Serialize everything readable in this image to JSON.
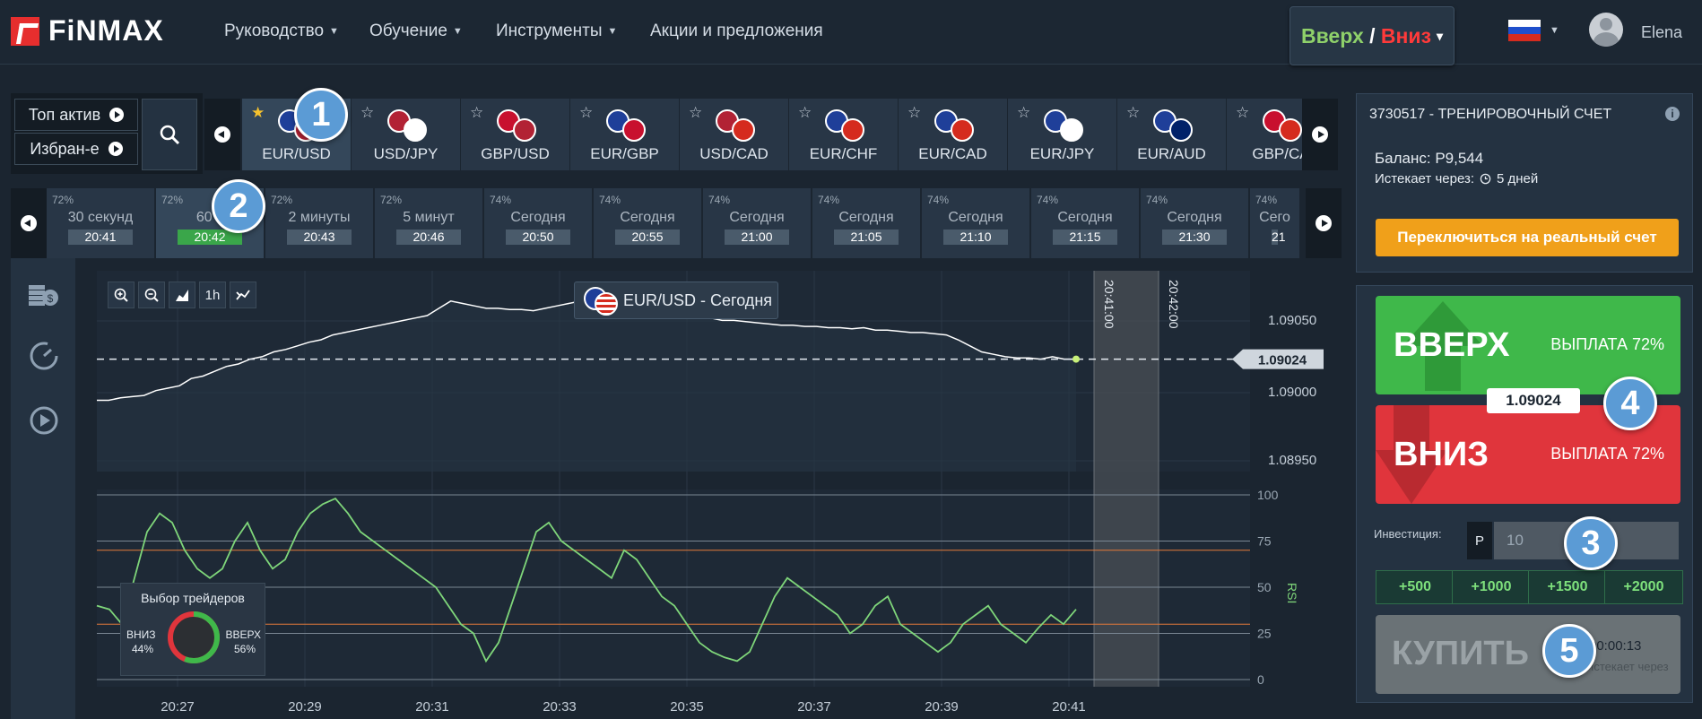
{
  "header": {
    "logo": "FiNMAX",
    "nav": [
      {
        "label": "Руководство",
        "dropdown": true
      },
      {
        "label": "Обучение",
        "dropdown": true
      },
      {
        "label": "Инструменты",
        "dropdown": true
      },
      {
        "label": "Акции и предложения",
        "dropdown": false
      }
    ],
    "mode_up": "Вверх",
    "mode_sep": " / ",
    "mode_down": "Вниз",
    "mode_caret": "▾",
    "language": "ru",
    "user_name": "Elena"
  },
  "asset_selector": {
    "top_assets": "Топ актив",
    "favorites": "Избран-е",
    "assets": [
      {
        "label": "EUR/USD",
        "favorite": true,
        "active": true
      },
      {
        "label": "USD/JPY",
        "favorite": false
      },
      {
        "label": "GBP/USD",
        "favorite": false
      },
      {
        "label": "EUR/GBP",
        "favorite": false
      },
      {
        "label": "USD/CAD",
        "favorite": false
      },
      {
        "label": "EUR/CHF",
        "favorite": false
      },
      {
        "label": "EUR/CAD",
        "favorite": false
      },
      {
        "label": "EUR/JPY",
        "favorite": false
      },
      {
        "label": "EUR/AUD",
        "favorite": false
      },
      {
        "label": "GBP/CA",
        "favorite": false
      }
    ]
  },
  "expiry_selector": {
    "options": [
      {
        "payout": "72%",
        "name": "30 секунд",
        "time": "20:41"
      },
      {
        "payout": "72%",
        "name": "60 с",
        "time": "20:42",
        "active": true
      },
      {
        "payout": "72%",
        "name": "2 минуты",
        "time": "20:43"
      },
      {
        "payout": "72%",
        "name": "5 минут",
        "time": "20:46"
      },
      {
        "payout": "74%",
        "name": "Сегодня",
        "time": "20:50"
      },
      {
        "payout": "74%",
        "name": "Сегодня",
        "time": "20:55"
      },
      {
        "payout": "74%",
        "name": "Сегодня",
        "time": "21:00"
      },
      {
        "payout": "74%",
        "name": "Сегодня",
        "time": "21:05"
      },
      {
        "payout": "74%",
        "name": "Сегодня",
        "time": "21:10"
      },
      {
        "payout": "74%",
        "name": "Сегодня",
        "time": "21:15"
      },
      {
        "payout": "74%",
        "name": "Сегодня",
        "time": "21:30"
      },
      {
        "payout": "74%",
        "name": "Сего",
        "time": "21"
      }
    ]
  },
  "chart": {
    "title_asset": "EUR/USD",
    "title_sep": " - ",
    "title_period": "Сегодня",
    "timeframe": "1h",
    "current_price": "1.09024",
    "price_ticks": [
      "1.09050",
      "1.09000",
      "1.08950"
    ],
    "expiry_markers": [
      "20:41:00",
      "20:42:00"
    ],
    "x_ticks": [
      "20:27",
      "20:29",
      "20:31",
      "20:33",
      "20:35",
      "20:37",
      "20:39",
      "20:41"
    ],
    "rsi_label": "RSI",
    "rsi_ticks": [
      "100",
      "75",
      "50",
      "25",
      "0"
    ],
    "price_series": [
      10,
      10,
      12,
      13,
      14,
      18,
      20,
      22,
      28,
      30,
      34,
      38,
      40,
      44,
      46,
      50,
      52,
      55,
      58,
      60,
      64,
      66,
      68,
      70,
      72,
      74,
      76,
      78,
      80,
      86,
      92,
      90,
      88,
      86,
      86,
      85,
      85,
      84,
      86,
      88,
      90,
      92,
      93,
      94,
      96,
      97,
      96,
      95,
      94,
      90,
      85,
      80,
      78,
      76,
      76,
      75,
      74,
      73,
      72,
      72,
      71,
      71,
      70,
      70,
      69,
      70,
      68,
      68,
      67,
      66,
      66,
      65,
      64,
      60,
      55,
      50,
      48,
      46,
      45,
      45,
      44,
      46,
      44,
      44
    ],
    "rsi_series": [
      40,
      38,
      30,
      55,
      80,
      90,
      85,
      70,
      60,
      55,
      60,
      75,
      85,
      70,
      60,
      65,
      80,
      90,
      95,
      98,
      90,
      80,
      75,
      70,
      65,
      60,
      55,
      50,
      40,
      30,
      25,
      10,
      20,
      40,
      60,
      80,
      85,
      75,
      70,
      65,
      60,
      55,
      70,
      65,
      55,
      45,
      40,
      30,
      20,
      15,
      12,
      10,
      15,
      30,
      45,
      55,
      50,
      45,
      40,
      35,
      25,
      30,
      40,
      45,
      30,
      25,
      20,
      15,
      20,
      30,
      35,
      40,
      30,
      25,
      20,
      28,
      35,
      30,
      38
    ]
  },
  "traders_choice": {
    "title": "Выбор трейдеров",
    "down_label": "ВНИЗ",
    "down_pct": "44%",
    "up_label": "ВВЕРХ",
    "up_pct": "56%",
    "up_fraction": 0.56
  },
  "account": {
    "title": "3730517 - ТРЕНИРОВОЧНЫЙ СЧЕТ",
    "balance": "Баланс: Р9,544",
    "expires_label": "Истекает через:",
    "expires_value": "5 дней",
    "switch_real": "Переключиться на реальный счет"
  },
  "trade": {
    "up_label": "ВВЕРХ",
    "up_payout": "ВЫПЛАТА 72%",
    "down_label": "ВНИЗ",
    "down_payout": "ВЫПЛАТА 72%",
    "current_price": "1.09024",
    "investment_label": "Инвестиция:",
    "currency": "Р",
    "investment_value": "10",
    "quick_add": [
      "+500",
      "+1000",
      "+1500",
      "+2000"
    ],
    "buy_label": "КУПИТЬ",
    "timer": "00:00:13",
    "timer_caption": "Истекает через"
  },
  "callouts": [
    "1",
    "2",
    "3",
    "4",
    "5"
  ],
  "colors": {
    "accent_green": "#3fb84a",
    "accent_red": "#e0353c",
    "orange": "#f0a01a",
    "callout_blue": "#5b9bd5"
  }
}
